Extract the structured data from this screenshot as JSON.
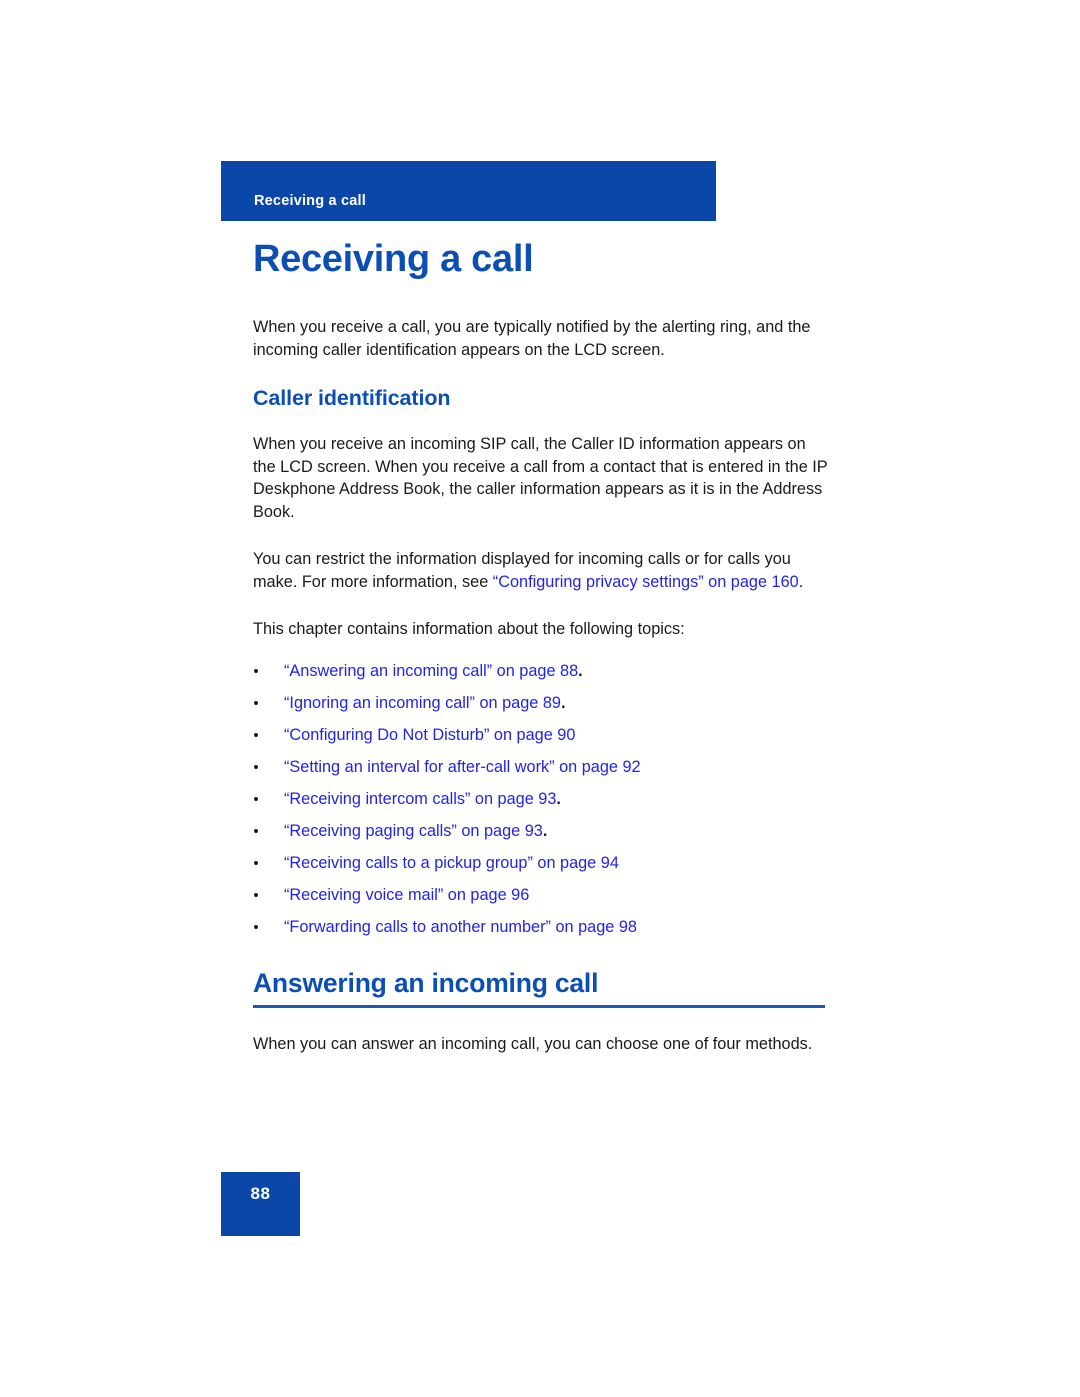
{
  "document": {
    "running_header": "Receiving a call",
    "chapter_title": "Receiving a call",
    "folio": "88"
  },
  "intro": {
    "paragraph": "When you receive a call, you are typically notified by the alerting ring, and the incoming caller identification appears on the LCD screen."
  },
  "caller_identification": {
    "heading": "Caller identification",
    "paragraph_1": "When you receive an incoming SIP call, the Caller ID information appears on the LCD screen. When you receive a call from a contact that is entered in the IP Deskphone Address Book, the caller information appears as it is in the Address Book.",
    "paragraph_2_pre": "You can restrict the information displayed for incoming calls or for calls you make. For more information, see ",
    "paragraph_2_link": "“Configuring privacy settings” on page 160",
    "paragraph_2_post": ".",
    "topics_intro": "This chapter contains information about the following topics:"
  },
  "topics": [
    {
      "label": "“Answering an incoming call” on page 88",
      "suffix": "."
    },
    {
      "label": "“Ignoring an incoming call” on page 89",
      "suffix": "."
    },
    {
      "label": "“Configuring Do Not Disturb” on page 90",
      "suffix": ""
    },
    {
      "label": "“Setting an interval for after-call work” on page 92",
      "suffix": ""
    },
    {
      "label": "“Receiving intercom calls” on page 93",
      "suffix": "."
    },
    {
      "label": "“Receiving paging calls” on page 93",
      "suffix": "."
    },
    {
      "label": "“Receiving calls to a pickup group” on page 94",
      "suffix": ""
    },
    {
      "label": "“Receiving voice mail” on page 96",
      "suffix": ""
    },
    {
      "label": "“Forwarding calls to another number” on page 98",
      "suffix": ""
    }
  ],
  "answering": {
    "heading": "Answering an incoming call",
    "paragraph": "When you can answer an incoming call, you can choose one of four methods."
  },
  "colors": {
    "brand_blue": "#0b47a8",
    "heading_blue": "#0b4fb4",
    "link_blue": "#2323e6",
    "rule_blue": "#1b58b8",
    "body_text": "#1a1a1a"
  }
}
